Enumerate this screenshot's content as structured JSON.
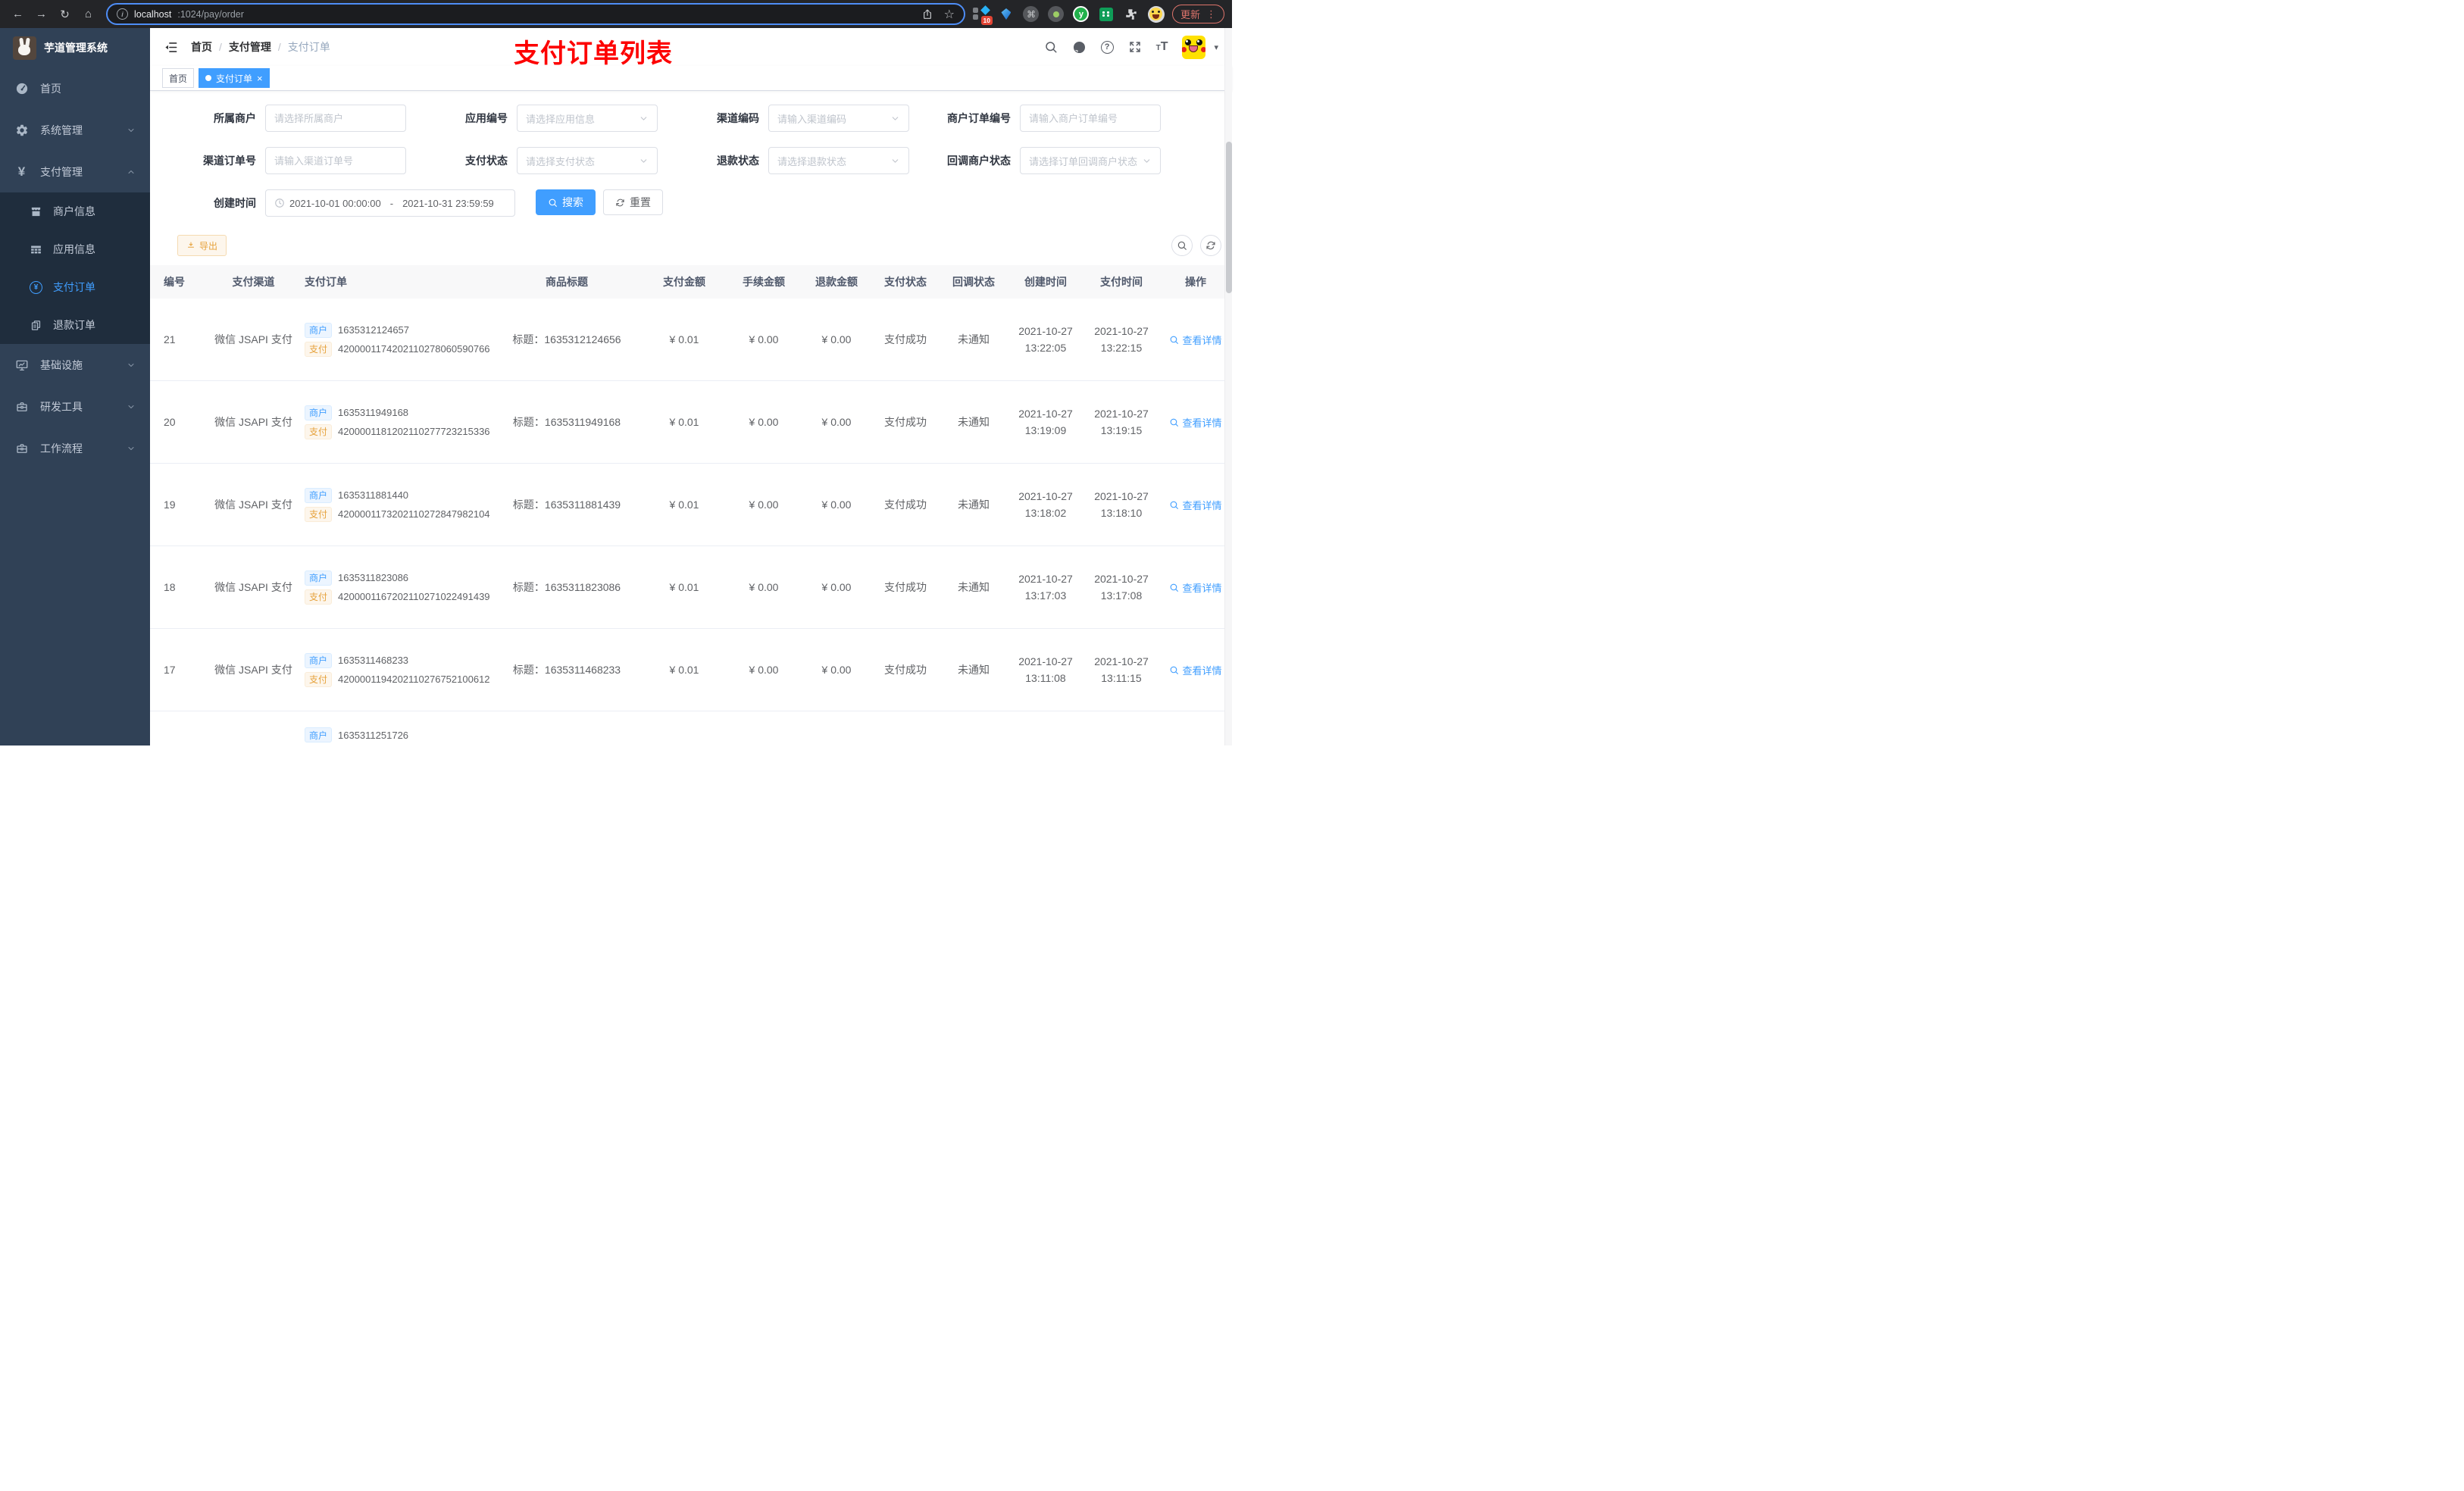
{
  "browser": {
    "url_host": "localhost",
    "url_path": ":1024/pay/order",
    "ext_badge": "10",
    "update_label": "更新"
  },
  "glyphs": {
    "back": "←",
    "forward": "→",
    "reload": "↻",
    "home": "⌂",
    "info": "i",
    "star": "☆",
    "command": "⌘",
    "dots": "⋮",
    "caret": "▾",
    "question": "?",
    "close": "×",
    "yen": "¥",
    "font_small": "T",
    "font_big": "T",
    "y_ext": "y"
  },
  "sidebar": {
    "title": "芋道管理系统",
    "home": "首页",
    "system": "系统管理",
    "pay": "支付管理",
    "merchant_info": "商户信息",
    "app_info": "应用信息",
    "pay_order": "支付订单",
    "refund_order": "退款订单",
    "infra": "基础设施",
    "dev_tools": "研发工具",
    "workflow": "工作流程"
  },
  "navbar": {
    "crumb_home": "首页",
    "crumb_pay": "支付管理",
    "crumb_order": "支付订单",
    "sep": "/",
    "annotation": "支付订单列表"
  },
  "tags": {
    "home": "首页",
    "active": "支付订单"
  },
  "filters": {
    "merchant_label": "所属商户",
    "merchant_ph": "请选择所属商户",
    "app_label": "应用编号",
    "app_ph": "请选择应用信息",
    "channel_code_label": "渠道编码",
    "channel_code_ph": "请输入渠道编码",
    "merchant_order_label": "商户订单编号",
    "merchant_order_ph": "请输入商户订单编号",
    "channel_order_label": "渠道订单号",
    "channel_order_ph": "请输入渠道订单号",
    "pay_status_label": "支付状态",
    "pay_status_ph": "请选择支付状态",
    "refund_status_label": "退款状态",
    "refund_status_ph": "请选择退款状态",
    "callback_label": "回调商户状态",
    "callback_ph": "请选择订单回调商户状态",
    "time_label": "创建时间",
    "time_start": "2021-10-01 00:00:00",
    "time_sep": "-",
    "time_end": "2021-10-31 23:59:59",
    "search": "搜索",
    "reset": "重置"
  },
  "toolbar": {
    "export": "导出"
  },
  "table": {
    "columns": [
      "编号",
      "支付渠道",
      "支付订单",
      "商品标题",
      "支付金额",
      "手续金额",
      "退款金额",
      "支付状态",
      "回调状态",
      "创建时间",
      "支付时间",
      "操作"
    ],
    "tag_merchant": "商户",
    "tag_pay": "支付",
    "action": "查看详情",
    "rows": [
      {
        "id": "21",
        "channel": "微信 JSAPI 支付",
        "merchant_no": "1635312124657",
        "pay_no": "4200001174202110278060590766",
        "title": "标题：1635312124656",
        "amount": "¥ 0.01",
        "fee": "¥ 0.00",
        "refund": "¥ 0.00",
        "status": "支付成功",
        "notify": "未通知",
        "create_date": "2021-10-27",
        "create_time": "13:22:05",
        "pay_date": "2021-10-27",
        "pay_time": "13:22:15"
      },
      {
        "id": "20",
        "channel": "微信 JSAPI 支付",
        "merchant_no": "1635311949168",
        "pay_no": "4200001181202110277723215336",
        "title": "标题：1635311949168",
        "amount": "¥ 0.01",
        "fee": "¥ 0.00",
        "refund": "¥ 0.00",
        "status": "支付成功",
        "notify": "未通知",
        "create_date": "2021-10-27",
        "create_time": "13:19:09",
        "pay_date": "2021-10-27",
        "pay_time": "13:19:15"
      },
      {
        "id": "19",
        "channel": "微信 JSAPI 支付",
        "merchant_no": "1635311881440",
        "pay_no": "4200001173202110272847982104",
        "title": "标题：1635311881439",
        "amount": "¥ 0.01",
        "fee": "¥ 0.00",
        "refund": "¥ 0.00",
        "status": "支付成功",
        "notify": "未通知",
        "create_date": "2021-10-27",
        "create_time": "13:18:02",
        "pay_date": "2021-10-27",
        "pay_time": "13:18:10"
      },
      {
        "id": "18",
        "channel": "微信 JSAPI 支付",
        "merchant_no": "1635311823086",
        "pay_no": "4200001167202110271022491439",
        "title": "标题：1635311823086",
        "amount": "¥ 0.01",
        "fee": "¥ 0.00",
        "refund": "¥ 0.00",
        "status": "支付成功",
        "notify": "未通知",
        "create_date": "2021-10-27",
        "create_time": "13:17:03",
        "pay_date": "2021-10-27",
        "pay_time": "13:17:08"
      },
      {
        "id": "17",
        "channel": "微信 JSAPI 支付",
        "merchant_no": "1635311468233",
        "pay_no": "4200001194202110276752100612",
        "title": "标题：1635311468233",
        "amount": "¥ 0.01",
        "fee": "¥ 0.00",
        "refund": "¥ 0.00",
        "status": "支付成功",
        "notify": "未通知",
        "create_date": "2021-10-27",
        "create_time": "13:11:08",
        "pay_date": "2021-10-27",
        "pay_time": "13:11:15"
      }
    ],
    "partial": {
      "merchant_no": "1635311251726"
    }
  }
}
